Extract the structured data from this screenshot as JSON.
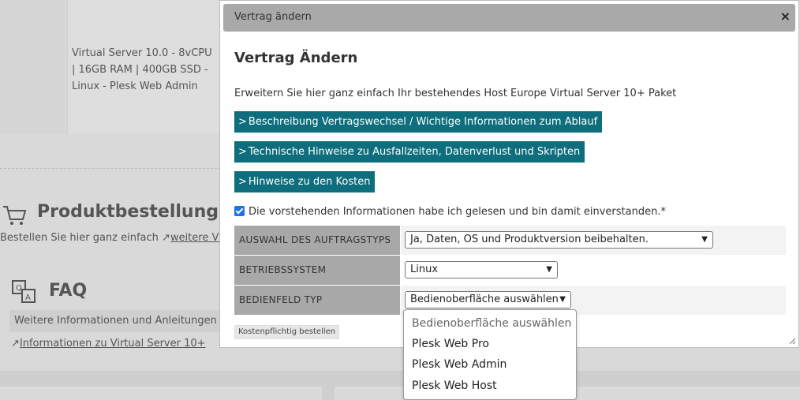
{
  "background": {
    "server_description": "Virtual Server 10.0 - 8vCPU | 16GB RAM | 400GB SSD - Linux - Plesk Web Admin",
    "product_section": {
      "title": "Produktbestellung",
      "subtitle": "Bestellen Sie hier ganz einfach",
      "link_arrow": "↗",
      "link": "weitere Virtu"
    },
    "faq_section": {
      "title": "FAQ",
      "info": "Weitere Informationen und Anleitungen fi",
      "link_arrow": "↗",
      "link": "Informationen zu Virtual Server 10+"
    }
  },
  "dialog": {
    "titlebar": "Vertrag ändern",
    "close_glyph": "×",
    "heading": "Vertrag Ändern",
    "intro": "Erweitern Sie hier ganz einfach Ihr bestehendes Host Europe Virtual Server 10+ Paket",
    "buttons": [
      {
        "label": "Beschreibung Vertragswechsel / Wichtige Informationen zum Ablauf"
      },
      {
        "label": "Technische Hinweise zu Ausfallzeiten, Datenverlust und Skripten"
      },
      {
        "label": "Hinweise zu den Kosten"
      }
    ],
    "chevron": ">",
    "consent": {
      "checked": true,
      "label": "Die vorstehenden Informationen habe ich gelesen und bin damit einverstanden.*"
    },
    "form": {
      "order_type": {
        "label": "AUSWAHL DES AUFTRAGSTYPS",
        "value": "Ja, Daten, OS und Produktversion beibehalten."
      },
      "os": {
        "label": "BETRIEBSSYSTEM",
        "value": "Linux"
      },
      "panel": {
        "label": "BEDIENFELD TYP",
        "value": "Bedienoberfläche auswählen"
      }
    },
    "submit_label": "Kostenpflichtig bestellen",
    "dropdown_options": [
      "Bedienoberfläche auswählen",
      "Plesk Web Pro",
      "Plesk Web Admin",
      "Plesk Web Host"
    ]
  },
  "colors": {
    "teal_button": "#0e6e7d",
    "checkbox": "#1a73e8",
    "titlebar": "#a9a9a9"
  }
}
